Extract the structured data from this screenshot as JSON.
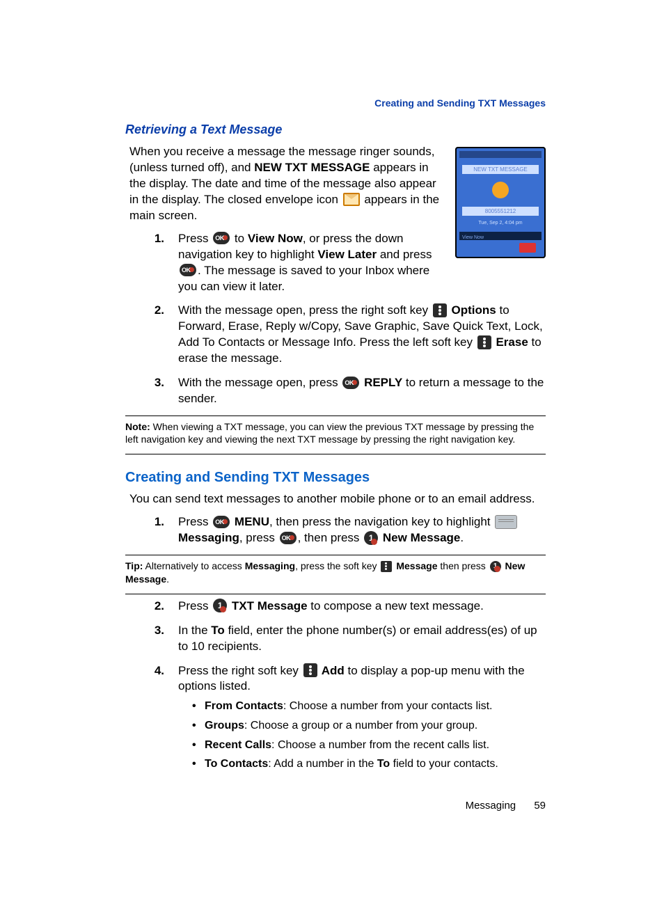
{
  "breadcrumb": "Creating and Sending TXT Messages",
  "sec1": {
    "heading": "Retrieving a Text Message",
    "intro_parts": {
      "a": "When you receive a message the message ringer sounds, (unless turned off), and ",
      "b_bold": "NEW TXT MESSAGE",
      "c": " appears in the display. The date and time of the message also appear in the display. The closed envelope icon ",
      "d": " appears in the main screen."
    },
    "li1": {
      "a": "Press ",
      "b_bold": " to ",
      "vn": "View Now",
      "c": ", or press the down navigation key to highlight ",
      "vl": "View Later",
      "d": " and press ",
      "e": ". The message is saved to your Inbox where you can view it later."
    },
    "li2": {
      "a": "With the message open, press the right soft key ",
      "opt": " Options",
      "b": " to Forward, Erase, Reply w/Copy, Save Graphic, Save Quick Text, Lock, Add To Contacts or Message Info. Press the left soft key ",
      "er": " Erase",
      "c": " to erase the message."
    },
    "li3": {
      "a": "With the message open, press ",
      "rep": " REPLY",
      "b": " to return a message to the sender."
    },
    "note": {
      "title": "Note:",
      "body": " When viewing a TXT message, you can view the previous TXT message by pressing the left navigation key and viewing the next TXT message by pressing the right navigation key."
    }
  },
  "sec2": {
    "heading": "Creating and Sending TXT Messages",
    "intro": "You can send text messages to another mobile phone or to an email address.",
    "li1": {
      "a": "Press ",
      "menu": " MENU",
      "b": ", then press the navigation key to highlight ",
      "mg": "Messaging",
      "c": ", press ",
      "d": ", then press ",
      "nm": " New Message",
      "e": "."
    },
    "tip": {
      "title": "Tip:",
      "a": " Alternatively to access ",
      "mg": "Messaging",
      "b": ", press the soft key ",
      "msg": " Message",
      "c": " then press ",
      "nm": " New Message",
      "d": "."
    },
    "li2": {
      "a": "Press ",
      "tm": " TXT Message",
      "b": " to compose a new text message."
    },
    "li3": {
      "a": "In the ",
      "to": "To",
      "b": " field, enter the phone number(s) or email address(es) of up to 10 recipients."
    },
    "li4": {
      "a": "Press the right soft key ",
      "add": " Add",
      "b": " to display a pop-up menu with the options listed."
    },
    "sub": [
      {
        "t": "From Contacts",
        "d": ": Choose a number from your contacts list."
      },
      {
        "t": "Groups",
        "d": ": Choose a group or a number from your group."
      },
      {
        "t": "Recent Calls",
        "d": ": Choose a number from the recent calls list."
      },
      {
        "t": "To Contacts",
        "d": ": Add a number in the ",
        "to": "To",
        "e": " field to your contacts."
      }
    ]
  },
  "footer": {
    "chapter": "Messaging",
    "page": "59"
  },
  "nums": {
    "n1": "1.",
    "n2": "2.",
    "n3": "3.",
    "n4": "4."
  }
}
